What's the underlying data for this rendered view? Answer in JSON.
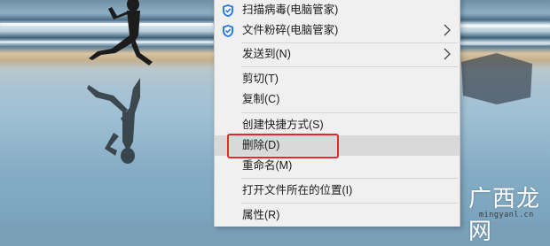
{
  "context_menu": {
    "items": [
      {
        "label": "扫描病毒(电脑管家)",
        "icon": "tencent-pc-manager-icon",
        "submenu": false
      },
      {
        "label": "文件粉碎(电脑管家)",
        "icon": "tencent-pc-manager-icon",
        "submenu": true
      },
      {
        "label": "发送到(N)",
        "icon": "",
        "submenu": true
      },
      {
        "label": "剪切(T)",
        "icon": "",
        "submenu": false
      },
      {
        "label": "复制(C)",
        "icon": "",
        "submenu": false
      },
      {
        "label": "创建快捷方式(S)",
        "icon": "",
        "submenu": false
      },
      {
        "label": "删除(D)",
        "icon": "",
        "submenu": false,
        "highlighted": true,
        "annotated": true
      },
      {
        "label": "重命名(M)",
        "icon": "",
        "submenu": false
      },
      {
        "label": "打开文件所在的位置(I)",
        "icon": "",
        "submenu": false
      },
      {
        "label": "属性(R)",
        "icon": "",
        "submenu": false
      }
    ],
    "highlight_color": "#d9d9d9",
    "annotation_color": "#e8262c"
  },
  "watermark": {
    "text": "广西龙网",
    "url": "mingyanl.cn"
  }
}
